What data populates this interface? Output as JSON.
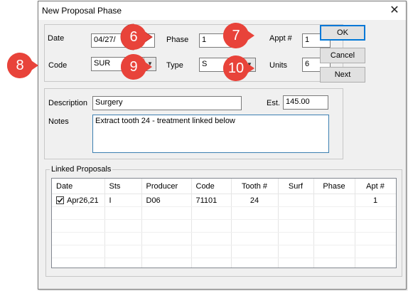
{
  "window": {
    "title": "New Proposal Phase",
    "close_glyph": "✕"
  },
  "fields": {
    "date": {
      "label": "Date",
      "value": "04/27/"
    },
    "phase": {
      "label": "Phase",
      "value": "1"
    },
    "appt": {
      "label": "Appt #",
      "value": "1"
    },
    "code": {
      "label": "Code",
      "value": "SUR"
    },
    "type": {
      "label": "Type",
      "value": "S"
    },
    "units": {
      "label": "Units",
      "value": "6"
    },
    "description": {
      "label": "Description",
      "value": "Surgery"
    },
    "est": {
      "label": "Est.",
      "value": "145.00"
    },
    "notes": {
      "label": "Notes",
      "value": "Extract tooth 24 - treatment linked below"
    }
  },
  "buttons": {
    "ok": "OK",
    "cancel": "Cancel",
    "next": "Next"
  },
  "linked": {
    "legend": "Linked Proposals",
    "columns": [
      "Date",
      "Sts",
      "Producer",
      "Code",
      "Tooth #",
      "Surf",
      "Phase",
      "Apt #"
    ],
    "rows": [
      {
        "checked": true,
        "date": "Apr26,21",
        "sts": "I",
        "producer": "D06",
        "code": "71101",
        "tooth": "24",
        "surf": "",
        "phase": "",
        "apt": "1"
      }
    ]
  },
  "badges": {
    "b6": "6",
    "b7": "7",
    "b8": "8",
    "b9": "9",
    "b10": "10"
  },
  "colors": {
    "badge": "#e8433a",
    "accent": "#0078d7"
  }
}
